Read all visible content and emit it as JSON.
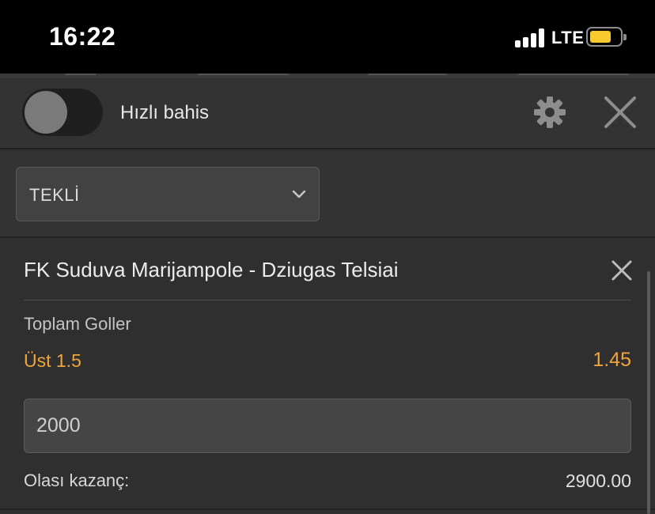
{
  "status": {
    "time": "16:22",
    "network": "LTE"
  },
  "quick_bet": {
    "label": "Hızlı bahis",
    "enabled": false
  },
  "header": {
    "settings_icon": "gear-icon",
    "close_icon": "close-icon"
  },
  "bet_type": {
    "selected": "TEKLİ"
  },
  "bet": {
    "match": "FK Suduva Marijampole - Dziugas Telsiai",
    "market": "Toplam Goller",
    "selection": "Üst 1.5",
    "odds": "1.45",
    "stake": "2000",
    "possible_win_label": "Olası kazanç:",
    "possible_win": "2900.00"
  },
  "colors": {
    "accent": "#f0a53b",
    "background": "#2f2f2f",
    "statusbar": "#000000",
    "battery": "#f7cb2e"
  }
}
